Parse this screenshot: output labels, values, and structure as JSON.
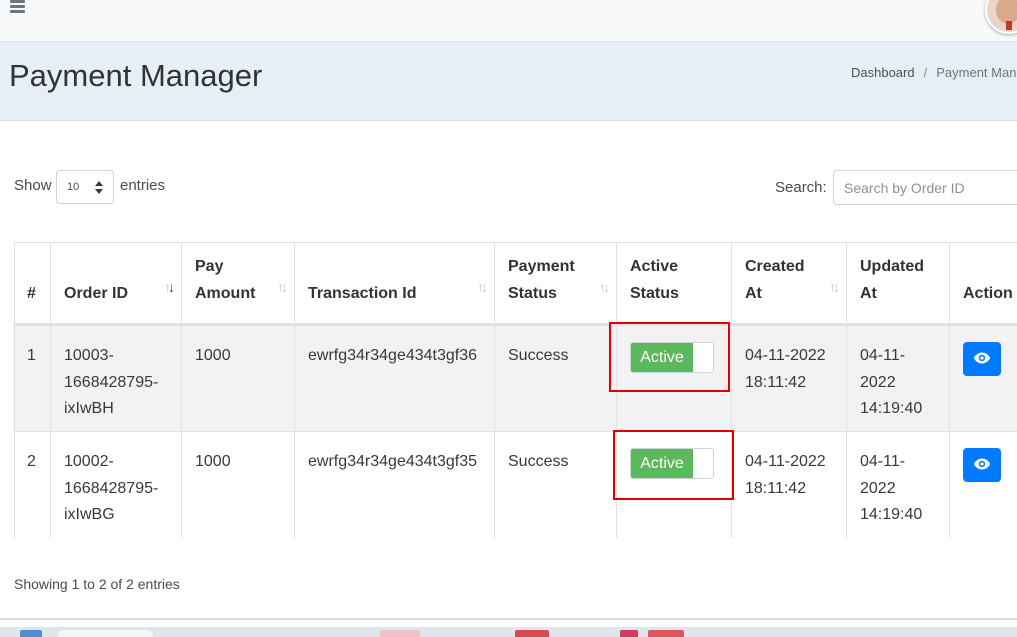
{
  "header": {
    "title": "Payment Manager"
  },
  "breadcrumb": {
    "home": "Dashboard",
    "separator": "/",
    "current": "Payment Manag"
  },
  "controls": {
    "show_label": "Show",
    "length_value": "10",
    "entries_label": "entries",
    "search_label": "Search:",
    "search_placeholder": "Search by Order ID"
  },
  "table": {
    "columns": {
      "index": "#",
      "order_id": "Order ID",
      "pay_amount": [
        "Pay",
        "Amount"
      ],
      "transaction_id": "Transaction Id",
      "payment_status": [
        "Payment",
        "Status"
      ],
      "active_status": [
        "Active",
        "Status"
      ],
      "created_at": [
        "Created",
        "At"
      ],
      "updated_at": [
        "Updated",
        "At"
      ],
      "action": "Action"
    },
    "rows": [
      {
        "index": "1",
        "order_id": [
          "10003-",
          "1668428795-",
          "ixIwBH"
        ],
        "pay_amount": "1000",
        "transaction_id": "ewrfg34r34ge434t3gf36",
        "payment_status": "Success",
        "active_status": "Active",
        "created_at": [
          "04-11-2022",
          "18:11:42"
        ],
        "updated_at": [
          "04-11-",
          "2022",
          "14:19:40"
        ]
      },
      {
        "index": "2",
        "order_id": [
          "10002-",
          "1668428795-",
          "ixIwBG"
        ],
        "pay_amount": "1000",
        "transaction_id": "ewrfg34r34ge434t3gf35",
        "payment_status": "Success",
        "active_status": "Active",
        "created_at": [
          "04-11-2022",
          "18:11:42"
        ],
        "updated_at": [
          "04-11-",
          "2022",
          "14:19:40"
        ]
      }
    ]
  },
  "footer": {
    "info": "Showing 1 to 2 of 2 entries"
  },
  "icons": {
    "menu": "hamburger-icon",
    "sort": "sort-arrows-icon",
    "view": "eye-icon"
  },
  "colors": {
    "toggle_active": "#5cb85c",
    "primary_button": "#007bff",
    "highlight_box": "#e00000",
    "header_bg": "#e8eef5"
  }
}
